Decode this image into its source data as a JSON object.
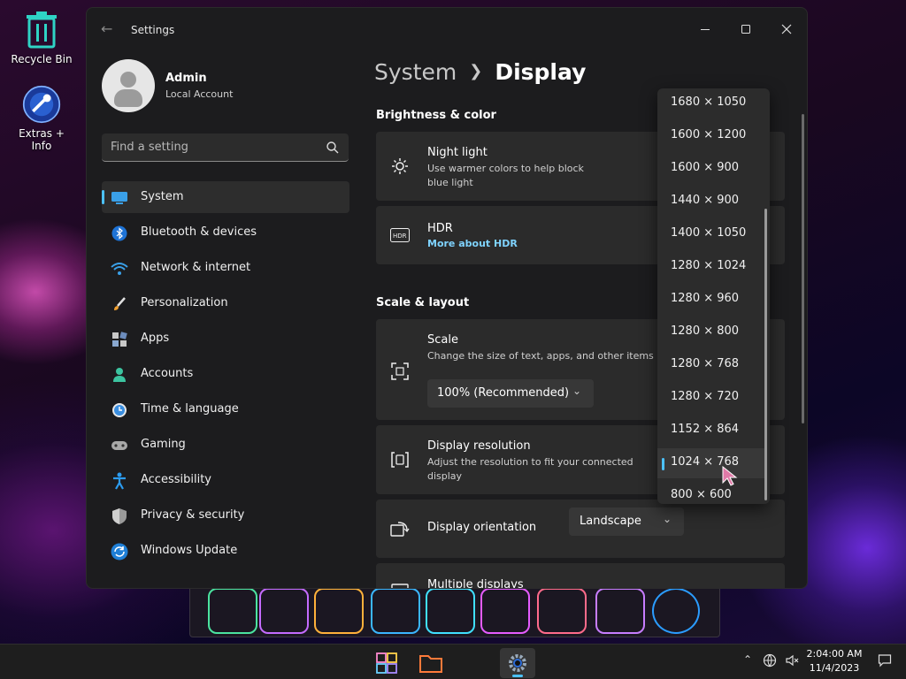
{
  "desktop": {
    "icons": [
      {
        "label": "Recycle Bin",
        "icon": "recycle-bin-icon"
      },
      {
        "label": "Extras + Info",
        "icon": "extras-info-icon"
      }
    ]
  },
  "window": {
    "title": "Settings",
    "controls": [
      "minimize",
      "maximize",
      "close"
    ]
  },
  "profile": {
    "name": "Admin",
    "account_type": "Local Account"
  },
  "search": {
    "placeholder": "Find a setting"
  },
  "sidebar": {
    "items": [
      {
        "label": "System",
        "icon": "system-icon",
        "active": true
      },
      {
        "label": "Bluetooth & devices",
        "icon": "bluetooth-icon"
      },
      {
        "label": "Network & internet",
        "icon": "network-icon"
      },
      {
        "label": "Personalization",
        "icon": "personalization-icon"
      },
      {
        "label": "Apps",
        "icon": "apps-icon"
      },
      {
        "label": "Accounts",
        "icon": "accounts-icon"
      },
      {
        "label": "Time & language",
        "icon": "time-language-icon"
      },
      {
        "label": "Gaming",
        "icon": "gaming-icon"
      },
      {
        "label": "Accessibility",
        "icon": "accessibility-icon"
      },
      {
        "label": "Privacy & security",
        "icon": "privacy-shield-icon"
      },
      {
        "label": "Windows Update",
        "icon": "windows-update-icon"
      }
    ]
  },
  "breadcrumb": {
    "parent": "System",
    "current": "Display"
  },
  "sections": {
    "brightness": "Brightness & color",
    "scale_layout": "Scale & layout"
  },
  "settings": {
    "night_light": {
      "title": "Night light",
      "desc": "Use warmer colors to help block blue light"
    },
    "hdr": {
      "title": "HDR",
      "link": "More about HDR"
    },
    "scale": {
      "title": "Scale",
      "desc": "Change the size of text, apps, and other items",
      "value": "100% (Recommended)"
    },
    "resolution": {
      "title": "Display resolution",
      "desc": "Adjust the resolution to fit your connected display"
    },
    "orientation": {
      "title": "Display orientation",
      "value": "Landscape"
    },
    "multiple_displays": {
      "title": "Multiple displays"
    }
  },
  "resolution_options": {
    "selected": "1024 × 768",
    "items": [
      "1680 × 1050",
      "1600 × 1200",
      "1600 × 900",
      "1440 × 900",
      "1400 × 1050",
      "1280 × 1024",
      "1280 × 960",
      "1280 × 800",
      "1280 × 768",
      "1280 × 720",
      "1152 × 864",
      "1024 × 768",
      "800 × 600"
    ]
  },
  "taskbar": {
    "apps": [
      "start-icon",
      "file-explorer-icon",
      "settings-gear-icon"
    ],
    "active_app": "settings-gear-icon",
    "time": "2:04:00 AM",
    "date": "11/4/2023"
  },
  "colors": {
    "accent": "#4cc2ff",
    "link": "#7fd3ff",
    "window_bg": "#1c1c1e",
    "card_bg": "#2b2b2b"
  }
}
